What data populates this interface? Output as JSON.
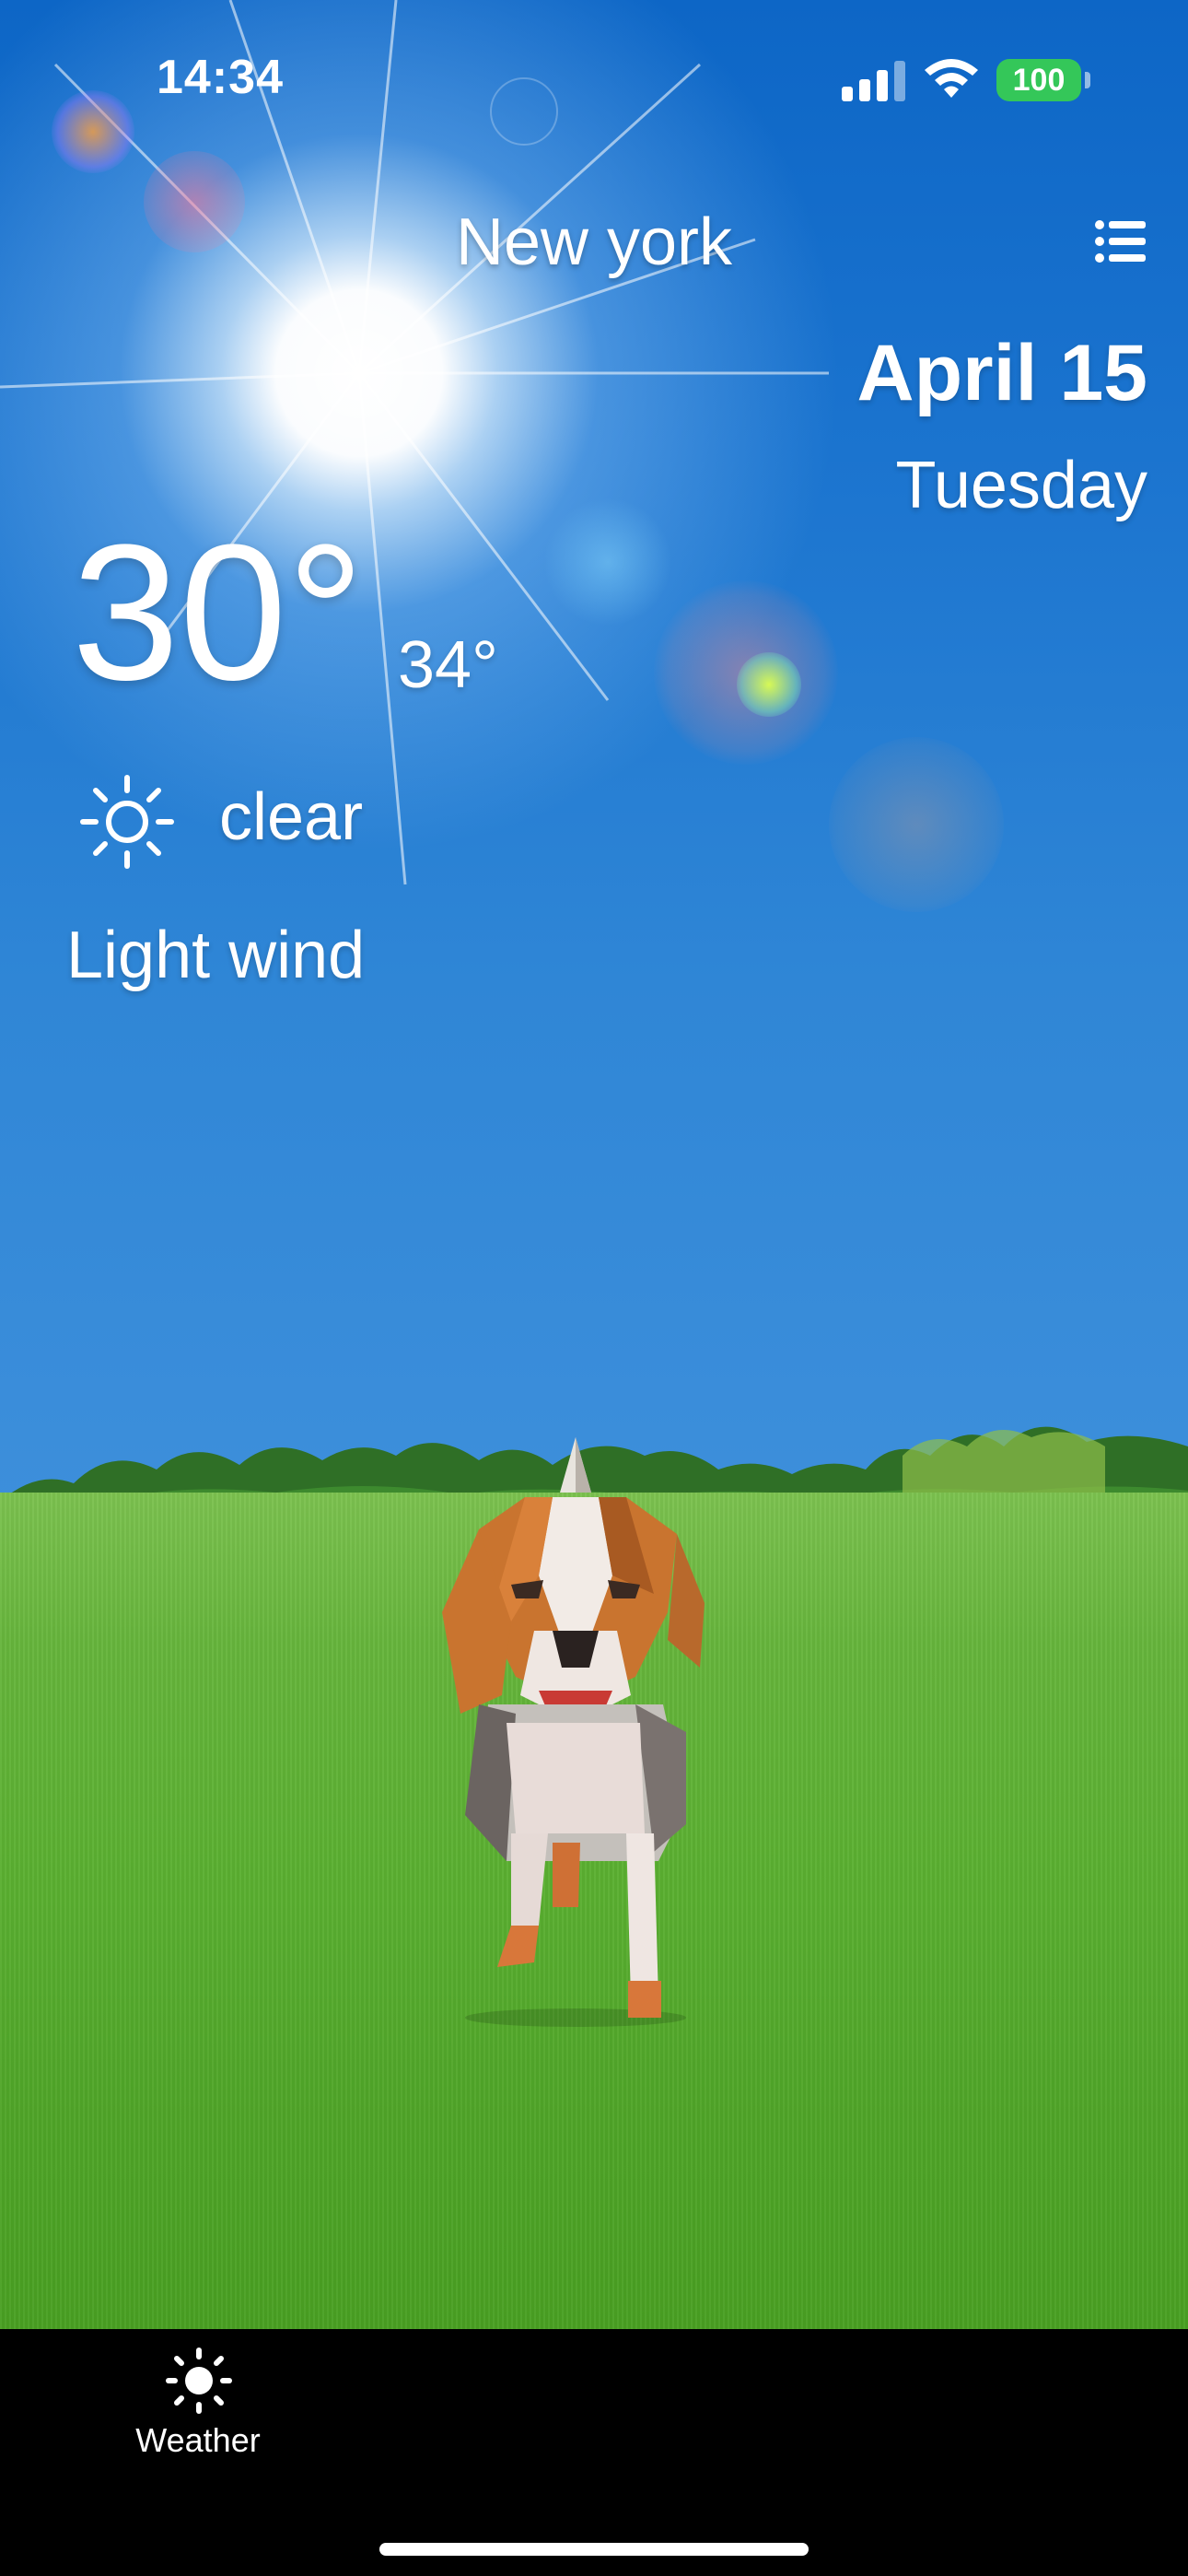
{
  "status_bar": {
    "time": "14:34",
    "battery": "100",
    "icons": [
      "cellular-signal-icon",
      "wifi-icon",
      "battery-icon"
    ]
  },
  "header": {
    "city": "New york",
    "menu_icon": "list-icon"
  },
  "date": {
    "date": "April 15",
    "weekday": "Tuesday"
  },
  "weather": {
    "temperature": "30°",
    "secondary_temperature": "34°",
    "condition": "clear",
    "condition_icon": "sun-icon",
    "wind": "Light wind"
  },
  "tab_bar": {
    "items": [
      {
        "label": "Weather",
        "icon": "sun-icon",
        "selected": true
      }
    ]
  },
  "colors": {
    "sky_top": "#0d66c6",
    "sky_bottom": "#3d8fdb",
    "grass": "#5bb031",
    "battery": "#34c759",
    "tab_bar": "#000000"
  }
}
